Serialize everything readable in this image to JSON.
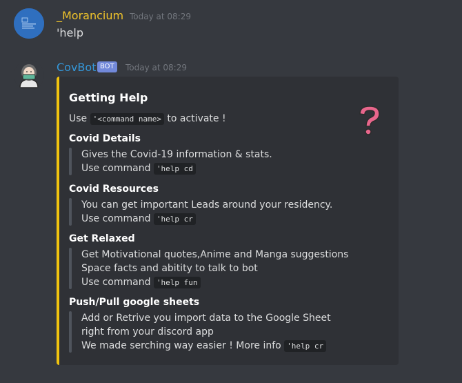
{
  "messages": {
    "user": {
      "name": "_Morancium",
      "timestamp": "Today at 08:29",
      "text": "'help"
    },
    "bot": {
      "name": "CovBot",
      "tag": "BOT",
      "timestamp": "Today at 08:29"
    }
  },
  "embed": {
    "title": "Getting Help",
    "intro_prefix": "Use ",
    "intro_code": "'<command name>",
    "intro_suffix": " to activate !",
    "accent_color": "#f1c40f",
    "thumbnail_icon": "question-mark-icon",
    "fields": [
      {
        "name": "Covid Details",
        "line1": "Gives the Covid-19 information & stats.",
        "cmd_prefix": "Use command ",
        "cmd": "'help cd"
      },
      {
        "name": "Covid Resources",
        "line1": "You can get important Leads around your residency.",
        "cmd_prefix": "Use command ",
        "cmd": "'help cr"
      },
      {
        "name": "Get Relaxed",
        "line1": "Get Motivational quotes,Anime and Manga suggestions",
        "line2": "Space facts and abitity to talk to bot",
        "cmd_prefix": "Use command ",
        "cmd": "'help fun"
      },
      {
        "name": "Push/Pull google sheets",
        "line1": "Add or Retrive you import data to the Google Sheet",
        "line2": "right from your discord app",
        "cmd_prefix": "We made serching way easier ! More info ",
        "cmd": "'help cr"
      }
    ]
  }
}
